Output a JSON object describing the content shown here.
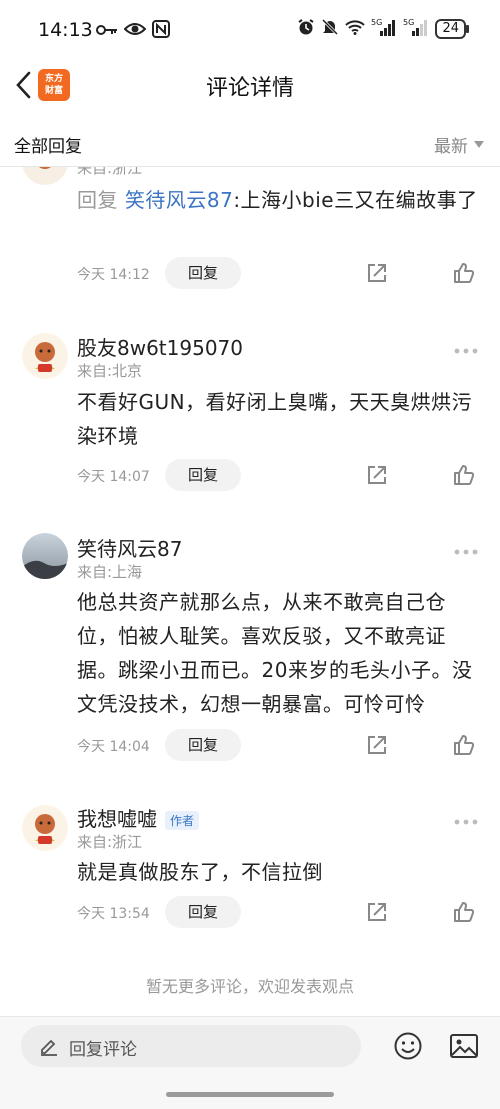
{
  "status_bar": {
    "time": "14:13",
    "battery": "24"
  },
  "nav": {
    "title": "评论详情",
    "logo_line1": "东方",
    "logo_line2": "财富"
  },
  "filter": {
    "all_label": "全部回复",
    "sort_label": "最新"
  },
  "comments": [
    {
      "location": "来自:浙江",
      "reply_prefix": "回复 ",
      "reply_target": "笑待风云87",
      "text": ":上海小bie三又在编故事了",
      "time": "今天 14:12",
      "reply_label": "回复"
    },
    {
      "username": "股友8w6t195070",
      "location": "来自:北京",
      "text": "不看好GUN，看好闭上臭嘴，天天臭烘烘污染环境",
      "time": "今天 14:07",
      "reply_label": "回复"
    },
    {
      "username": "笑待风云87",
      "location": "来自:上海",
      "text": "他总共资产就那么点，从来不敢亮自己仓位，怕被人耻笑。喜欢反驳，又不敢亮证据。跳梁小丑而已。20来岁的毛头小子。没文凭没技术，幻想一朝暴富。可怜可怜",
      "time": "今天 14:04",
      "reply_label": "回复"
    },
    {
      "username": "我想嘘嘘",
      "badge": "作者",
      "location": "来自:浙江",
      "text": "就是真做股东了，不信拉倒",
      "time": "今天 13:54",
      "reply_label": "回复"
    }
  ],
  "footer_note": "暂无更多评论，欢迎发表观点",
  "bottom_bar": {
    "input_placeholder": "回复评论"
  },
  "colors": {
    "link_blue": "#3a74c4",
    "logo_orange": "#f26a21",
    "muted": "#999999"
  }
}
